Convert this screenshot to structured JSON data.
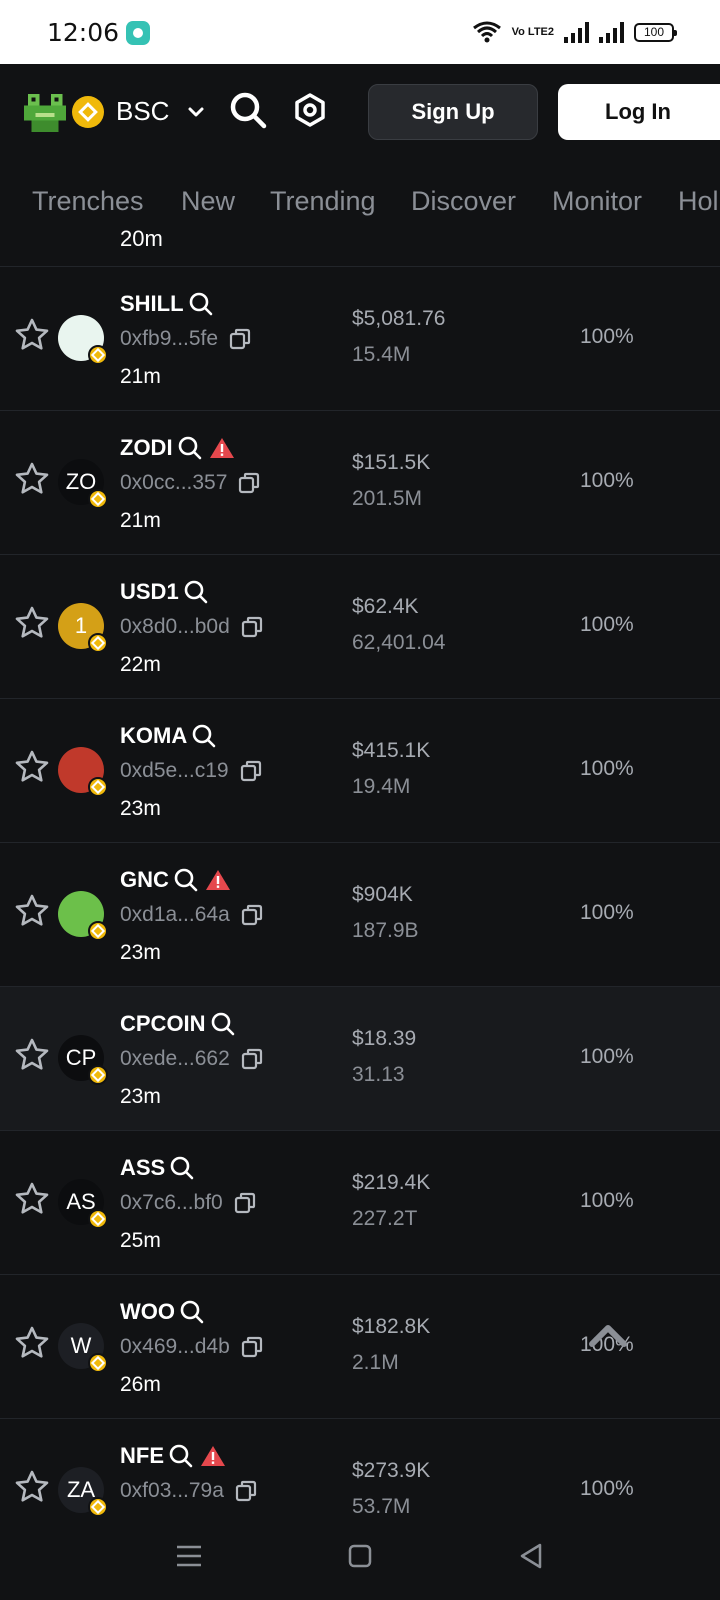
{
  "status_bar": {
    "time": "12:06",
    "volte": "Vo LTE2",
    "battery": "100"
  },
  "header": {
    "chain": "BSC",
    "sign_up": "Sign Up",
    "log_in": "Log In"
  },
  "tabs": [
    "Trenches",
    "New",
    "Trending",
    "Discover",
    "Monitor",
    "Hol"
  ],
  "partial_row": {
    "age": "20m"
  },
  "tokens": [
    {
      "name": "SHILL",
      "address": "0xfb9...5fe",
      "age": "21m",
      "price": "$5,081.76",
      "supply": "15.4M",
      "percent": "100%",
      "warning": false,
      "avatar_text": "",
      "avatar_color": "#e9f5ef"
    },
    {
      "name": "ZODI",
      "address": "0x0cc...357",
      "age": "21m",
      "price": "$151.5K",
      "supply": "201.5M",
      "percent": "100%",
      "warning": true,
      "avatar_text": "ZO",
      "avatar_color": "#0c0d0f"
    },
    {
      "name": "USD1",
      "address": "0x8d0...b0d",
      "age": "22m",
      "price": "$62.4K",
      "supply": "62,401.04",
      "percent": "100%",
      "warning": false,
      "avatar_text": "1",
      "avatar_color": "#d4a017"
    },
    {
      "name": "KOMA",
      "address": "0xd5e...c19",
      "age": "23m",
      "price": "$415.1K",
      "supply": "19.4M",
      "percent": "100%",
      "warning": false,
      "avatar_text": "",
      "avatar_color": "#c0392b"
    },
    {
      "name": "GNC",
      "address": "0xd1a...64a",
      "age": "23m",
      "price": "$904K",
      "supply": "187.9B",
      "percent": "100%",
      "warning": true,
      "avatar_text": "",
      "avatar_color": "#6cc04a"
    },
    {
      "name": "CPCOIN",
      "address": "0xede...662",
      "age": "23m",
      "price": "$18.39",
      "supply": "31.13",
      "percent": "100%",
      "warning": false,
      "avatar_text": "CP",
      "avatar_color": "#0c0d0f"
    },
    {
      "name": "ASS",
      "address": "0x7c6...bf0",
      "age": "25m",
      "price": "$219.4K",
      "supply": "227.2T",
      "percent": "100%",
      "warning": false,
      "avatar_text": "AS",
      "avatar_color": "#0c0d0f"
    },
    {
      "name": "WOO",
      "address": "0x469...d4b",
      "age": "26m",
      "price": "$182.8K",
      "supply": "2.1M",
      "percent": "100%",
      "warning": false,
      "avatar_text": "W",
      "avatar_color": "#1d1f24"
    },
    {
      "name": "NFE",
      "address": "0xf03...79a",
      "age": "",
      "price": "$273.9K",
      "supply": "53.7M",
      "percent": "100%",
      "warning": true,
      "avatar_text": "ZA",
      "avatar_color": "#1d1f24"
    }
  ],
  "colors": {
    "background": "#111214",
    "muted_text": "#8b8f96",
    "warning": "#e5484d",
    "bnb": "#f0b90b"
  }
}
